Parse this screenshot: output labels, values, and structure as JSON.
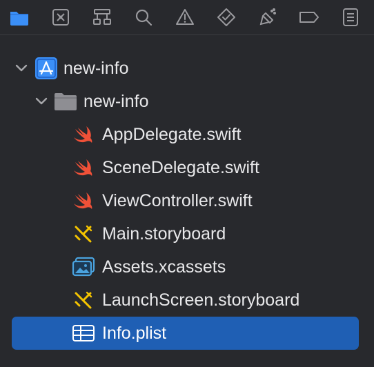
{
  "toolbar": {
    "icons": [
      {
        "name": "project-navigator-icon",
        "color": "#3b8ff7"
      },
      {
        "name": "source-control-icon",
        "color": "#9a9a9e"
      },
      {
        "name": "symbol-navigator-icon",
        "color": "#9a9a9e"
      },
      {
        "name": "find-navigator-icon",
        "color": "#9a9a9e"
      },
      {
        "name": "issue-navigator-icon",
        "color": "#9a9a9e"
      },
      {
        "name": "test-navigator-icon",
        "color": "#9a9a9e"
      },
      {
        "name": "debug-navigator-icon",
        "color": "#9a9a9e"
      },
      {
        "name": "breakpoint-navigator-icon",
        "color": "#9a9a9e"
      },
      {
        "name": "report-navigator-icon",
        "color": "#9a9a9e"
      }
    ]
  },
  "tree": {
    "project": {
      "label": "new-info",
      "icon": "xcode-project-icon",
      "expanded": true
    },
    "group": {
      "label": "new-info",
      "icon": "folder-icon",
      "expanded": true
    },
    "files": [
      {
        "label": "AppDelegate.swift",
        "icon": "swift-icon"
      },
      {
        "label": "SceneDelegate.swift",
        "icon": "swift-icon"
      },
      {
        "label": "ViewController.swift",
        "icon": "swift-icon"
      },
      {
        "label": "Main.storyboard",
        "icon": "storyboard-icon"
      },
      {
        "label": "Assets.xcassets",
        "icon": "asset-catalog-icon"
      },
      {
        "label": "LaunchScreen.storyboard",
        "icon": "storyboard-icon"
      },
      {
        "label": "Info.plist",
        "icon": "plist-icon",
        "selected": true
      }
    ]
  },
  "colors": {
    "background": "#28292d",
    "selection": "#1f5fb4",
    "accent": "#3b8ff7",
    "swift": "#f05138",
    "storyboard": "#f5c400",
    "assets": "#4aa3df"
  }
}
